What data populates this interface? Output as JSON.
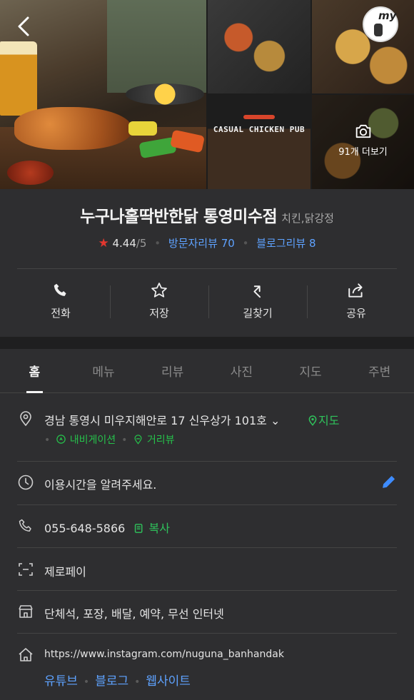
{
  "header": {
    "back_icon": "chevron-left-icon",
    "my_badge": "my",
    "photo_sign_text": "CASUAL CHICKEN PUB",
    "more_photos_label": "91개 더보기"
  },
  "place": {
    "name": "누구나홀딱반한닭 통영미수점",
    "category": "치킨,닭강정",
    "rating": "4.44",
    "rating_max": "/5",
    "visitor_reviews_label": "방문자리뷰",
    "visitor_reviews_count": "70",
    "blog_reviews_label": "블로그리뷰",
    "blog_reviews_count": "8"
  },
  "actions": [
    {
      "label": "전화",
      "icon": "phone-icon"
    },
    {
      "label": "저장",
      "icon": "star-outline-icon"
    },
    {
      "label": "길찾기",
      "icon": "directions-icon"
    },
    {
      "label": "공유",
      "icon": "share-icon"
    }
  ],
  "tabs": [
    "홈",
    "메뉴",
    "리뷰",
    "사진",
    "지도",
    "주변"
  ],
  "active_tab": "홈",
  "info": {
    "address": "경남 통영시 미우지해안로 17 신우상가 101호",
    "map_link": "지도",
    "navigation_link": "내비게이션",
    "streetview_link": "거리뷰",
    "hours_placeholder": "이용시간을 알려주세요.",
    "phone": "055-648-5866",
    "copy_label": "복사",
    "payment": "제로페이",
    "amenities": "단체석, 포장, 배달, 예약, 무선 인터넷",
    "website_url": "https://www.instagram.com/nuguna_banhandak",
    "links": [
      "유튜브",
      "블로그",
      "웹사이트"
    ]
  },
  "colors": {
    "background": "#2e2e30",
    "accent_green": "#2fc25b",
    "accent_blue": "#5ea2ff",
    "star_red": "#e2372f"
  }
}
